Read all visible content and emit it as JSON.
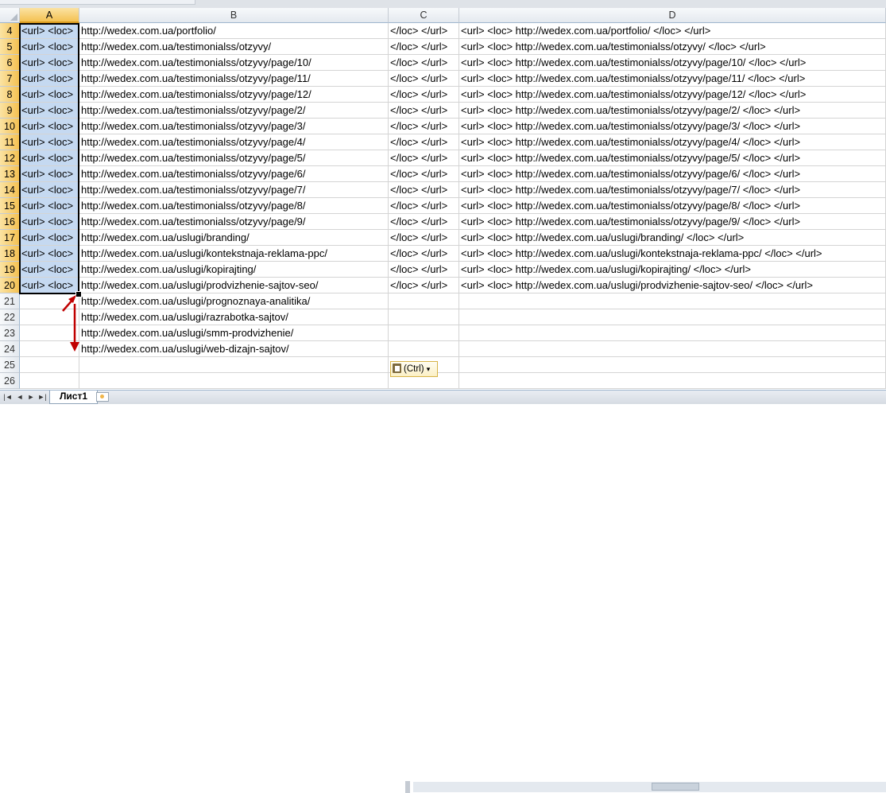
{
  "columns": [
    "A",
    "B",
    "C",
    "D"
  ],
  "rows": [
    {
      "num": "4",
      "a": "<url> <loc>",
      "b": "http://wedex.com.ua/portfolio/",
      "c": "</loc> </url>",
      "d": "<url> <loc>  http://wedex.com.ua/portfolio/ </loc> </url>"
    },
    {
      "num": "5",
      "a": "<url> <loc>",
      "b": "http://wedex.com.ua/testimonialss/otzyvy/",
      "c": "</loc> </url>",
      "d": "<url> <loc>  http://wedex.com.ua/testimonialss/otzyvy/ </loc> </url>"
    },
    {
      "num": "6",
      "a": "<url> <loc>",
      "b": "http://wedex.com.ua/testimonialss/otzyvy/page/10/",
      "c": "</loc> </url>",
      "d": "<url> <loc>  http://wedex.com.ua/testimonialss/otzyvy/page/10/ </loc> </url>"
    },
    {
      "num": "7",
      "a": "<url> <loc>",
      "b": "http://wedex.com.ua/testimonialss/otzyvy/page/11/",
      "c": "</loc> </url>",
      "d": "<url> <loc>  http://wedex.com.ua/testimonialss/otzyvy/page/11/ </loc> </url>"
    },
    {
      "num": "8",
      "a": "<url> <loc>",
      "b": "http://wedex.com.ua/testimonialss/otzyvy/page/12/",
      "c": "</loc> </url>",
      "d": "<url> <loc>  http://wedex.com.ua/testimonialss/otzyvy/page/12/ </loc> </url>"
    },
    {
      "num": "9",
      "a": "<url> <loc>",
      "b": "http://wedex.com.ua/testimonialss/otzyvy/page/2/",
      "c": "</loc> </url>",
      "d": "<url> <loc>  http://wedex.com.ua/testimonialss/otzyvy/page/2/ </loc> </url>"
    },
    {
      "num": "10",
      "a": "<url> <loc>",
      "b": "http://wedex.com.ua/testimonialss/otzyvy/page/3/",
      "c": "</loc> </url>",
      "d": "<url> <loc>  http://wedex.com.ua/testimonialss/otzyvy/page/3/ </loc> </url>"
    },
    {
      "num": "11",
      "a": "<url> <loc>",
      "b": "http://wedex.com.ua/testimonialss/otzyvy/page/4/",
      "c": "</loc> </url>",
      "d": "<url> <loc>  http://wedex.com.ua/testimonialss/otzyvy/page/4/ </loc> </url>"
    },
    {
      "num": "12",
      "a": "<url> <loc>",
      "b": "http://wedex.com.ua/testimonialss/otzyvy/page/5/",
      "c": "</loc> </url>",
      "d": "<url> <loc>  http://wedex.com.ua/testimonialss/otzyvy/page/5/ </loc> </url>"
    },
    {
      "num": "13",
      "a": "<url> <loc>",
      "b": "http://wedex.com.ua/testimonialss/otzyvy/page/6/",
      "c": "</loc> </url>",
      "d": "<url> <loc>  http://wedex.com.ua/testimonialss/otzyvy/page/6/ </loc> </url>"
    },
    {
      "num": "14",
      "a": "<url> <loc>",
      "b": "http://wedex.com.ua/testimonialss/otzyvy/page/7/",
      "c": "</loc> </url>",
      "d": "<url> <loc>  http://wedex.com.ua/testimonialss/otzyvy/page/7/ </loc> </url>"
    },
    {
      "num": "15",
      "a": "<url> <loc>",
      "b": "http://wedex.com.ua/testimonialss/otzyvy/page/8/",
      "c": "</loc> </url>",
      "d": "<url> <loc>  http://wedex.com.ua/testimonialss/otzyvy/page/8/ </loc> </url>"
    },
    {
      "num": "16",
      "a": "<url> <loc>",
      "b": "http://wedex.com.ua/testimonialss/otzyvy/page/9/",
      "c": "</loc> </url>",
      "d": "<url> <loc>  http://wedex.com.ua/testimonialss/otzyvy/page/9/ </loc> </url>"
    },
    {
      "num": "17",
      "a": "<url> <loc>",
      "b": "http://wedex.com.ua/uslugi/branding/",
      "c": "</loc> </url>",
      "d": "<url> <loc>  http://wedex.com.ua/uslugi/branding/ </loc> </url>"
    },
    {
      "num": "18",
      "a": "<url> <loc>",
      "b": "http://wedex.com.ua/uslugi/kontekstnaja-reklama-ppc/",
      "c": "</loc> </url>",
      "d": "<url> <loc>  http://wedex.com.ua/uslugi/kontekstnaja-reklama-ppc/ </loc> </url>"
    },
    {
      "num": "19",
      "a": "<url> <loc>",
      "b": "http://wedex.com.ua/uslugi/kopirajting/",
      "c": "</loc> </url>",
      "d": "<url> <loc>  http://wedex.com.ua/uslugi/kopirajting/ </loc> </url>"
    },
    {
      "num": "20",
      "a": "<url> <loc>",
      "b": "http://wedex.com.ua/uslugi/prodvizhenie-sajtov-seo/",
      "c": "</loc> </url>",
      "d": "<url> <loc>  http://wedex.com.ua/uslugi/prodvizhenie-sajtov-seo/ </loc> </url>"
    },
    {
      "num": "21",
      "a": "",
      "b": "http://wedex.com.ua/uslugi/prognoznaya-analitika/",
      "c": "",
      "d": ""
    },
    {
      "num": "22",
      "a": "",
      "b": "http://wedex.com.ua/uslugi/razrabotka-sajtov/",
      "c": "",
      "d": ""
    },
    {
      "num": "23",
      "a": "",
      "b": "http://wedex.com.ua/uslugi/smm-prodvizhenie/",
      "c": "",
      "d": ""
    },
    {
      "num": "24",
      "a": "",
      "b": "http://wedex.com.ua/uslugi/web-dizajn-sajtov/",
      "c": "",
      "d": ""
    },
    {
      "num": "25",
      "a": "",
      "b": "",
      "c": "",
      "d": ""
    },
    {
      "num": "26",
      "a": "",
      "b": "",
      "c": "",
      "d": ""
    }
  ],
  "paste_options": {
    "label": "(Ctrl)",
    "arrow": "▾"
  },
  "sheet_tabs": {
    "active": "Лист1"
  },
  "nav": {
    "first": "|◄",
    "prev": "◄",
    "next": "►",
    "last": "►|"
  },
  "colors": {
    "selection": "#c5d9f1",
    "annotation_arrow": "#c00000",
    "header_selected": "#f4c152"
  }
}
